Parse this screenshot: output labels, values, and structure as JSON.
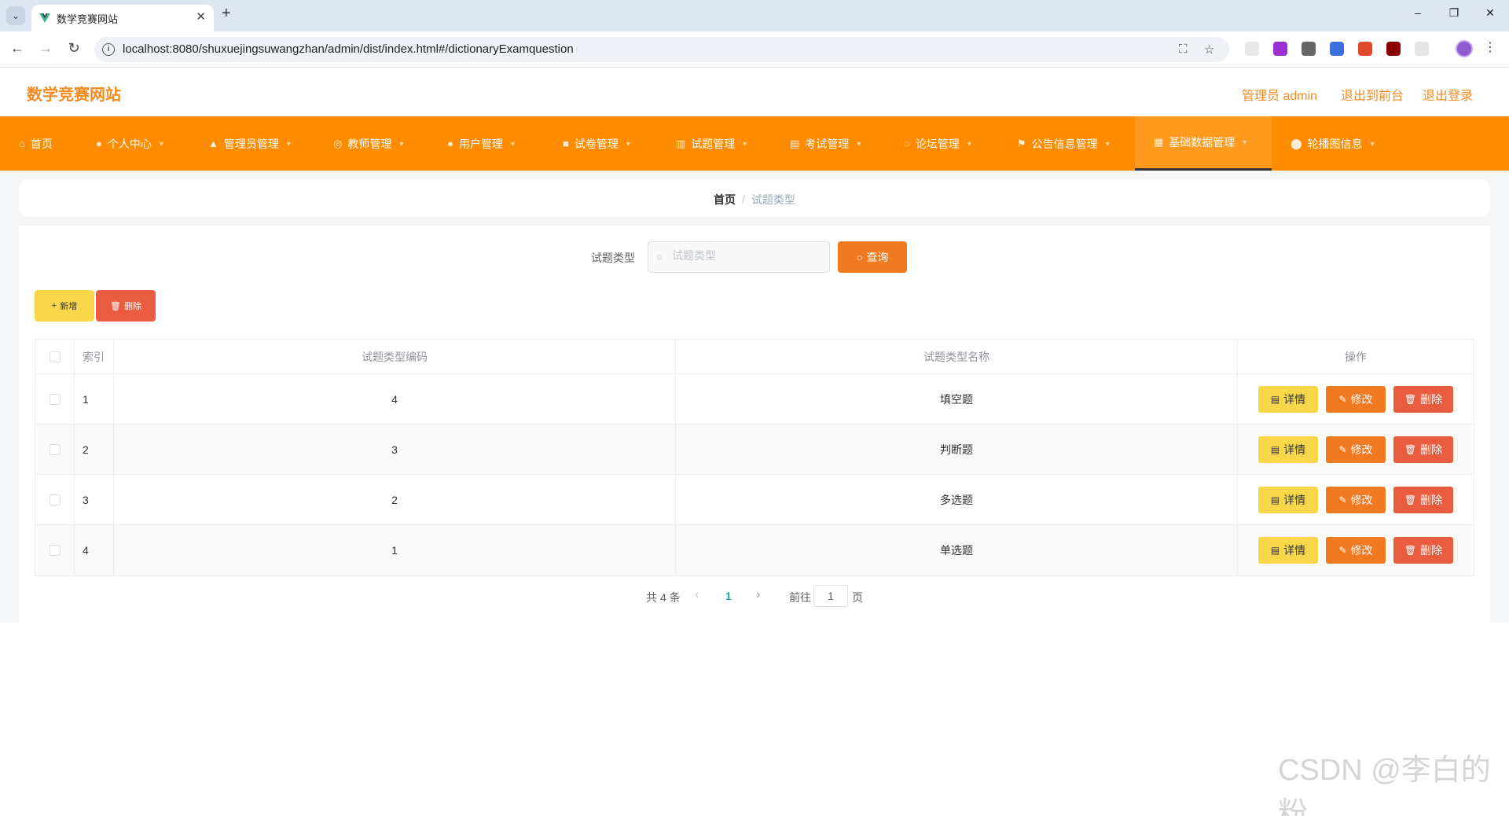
{
  "browser": {
    "tab_title": "数学竞赛网站",
    "tab_close": "✕",
    "new_tab": "+",
    "url": "localhost:8080/shuxuejingsuwangzhan/admin/dist/index.html#/dictionaryExamquestion",
    "colors": {
      "tabbar": "#dfe6f3",
      "favicon": "#41b883"
    }
  },
  "header": {
    "site_title": "数学竞赛网站",
    "user_label": "管理员 admin",
    "to_frontend": "退出到前台",
    "logout": "退出登录"
  },
  "nav": {
    "items": [
      {
        "label": "首页",
        "icon": "home-icon"
      },
      {
        "label": "个人中心",
        "icon": "user-icon"
      },
      {
        "label": "管理员管理",
        "icon": "admin-icon"
      },
      {
        "label": "教师管理",
        "icon": "teacher-icon"
      },
      {
        "label": "用户管理",
        "icon": "users-icon"
      },
      {
        "label": "试卷管理",
        "icon": "paper-icon"
      },
      {
        "label": "试题管理",
        "icon": "question-icon"
      },
      {
        "label": "考试管理",
        "icon": "exam-icon"
      },
      {
        "label": "论坛管理",
        "icon": "forum-icon"
      },
      {
        "label": "公告信息管理",
        "icon": "flag-icon"
      },
      {
        "label": "基础数据管理",
        "icon": "data-icon",
        "active": true
      },
      {
        "label": "轮播图信息",
        "icon": "location-icon"
      }
    ],
    "colors": {
      "background": "#ff8c00",
      "active": "#ff9a1f"
    }
  },
  "breadcrumb": {
    "home": "首页",
    "separator": "/",
    "current": "试题类型"
  },
  "search": {
    "label": "试题类型",
    "placeholder": "试题类型",
    "query_button": "查询"
  },
  "toolbar": {
    "add_label": "新增",
    "delete_label": "删除"
  },
  "table": {
    "headers": [
      "",
      "索引",
      "试题类型编码",
      "试题类型名称",
      "操作"
    ],
    "rows": [
      {
        "index": "1",
        "code": "4",
        "name": "填空题"
      },
      {
        "index": "2",
        "code": "3",
        "name": "判断题"
      },
      {
        "index": "3",
        "code": "2",
        "name": "多选题"
      },
      {
        "index": "4",
        "code": "1",
        "name": "单选题"
      }
    ],
    "actions": {
      "detail": "详情",
      "edit": "修改",
      "delete": "删除"
    }
  },
  "pagination": {
    "total_text": "共 4 条",
    "current_page": "1",
    "goto_label": "前往",
    "goto_value": "1",
    "page_suffix": "页"
  },
  "watermark": "CSDN @李白的粉",
  "colors": {
    "accent": "#ff8c00",
    "primary_button": "#ef7a22",
    "add_button": "#f8d84a",
    "delete_button": "#ea5c3f",
    "title_orange": "#f28a1f",
    "page_active": "#13a8a0"
  }
}
